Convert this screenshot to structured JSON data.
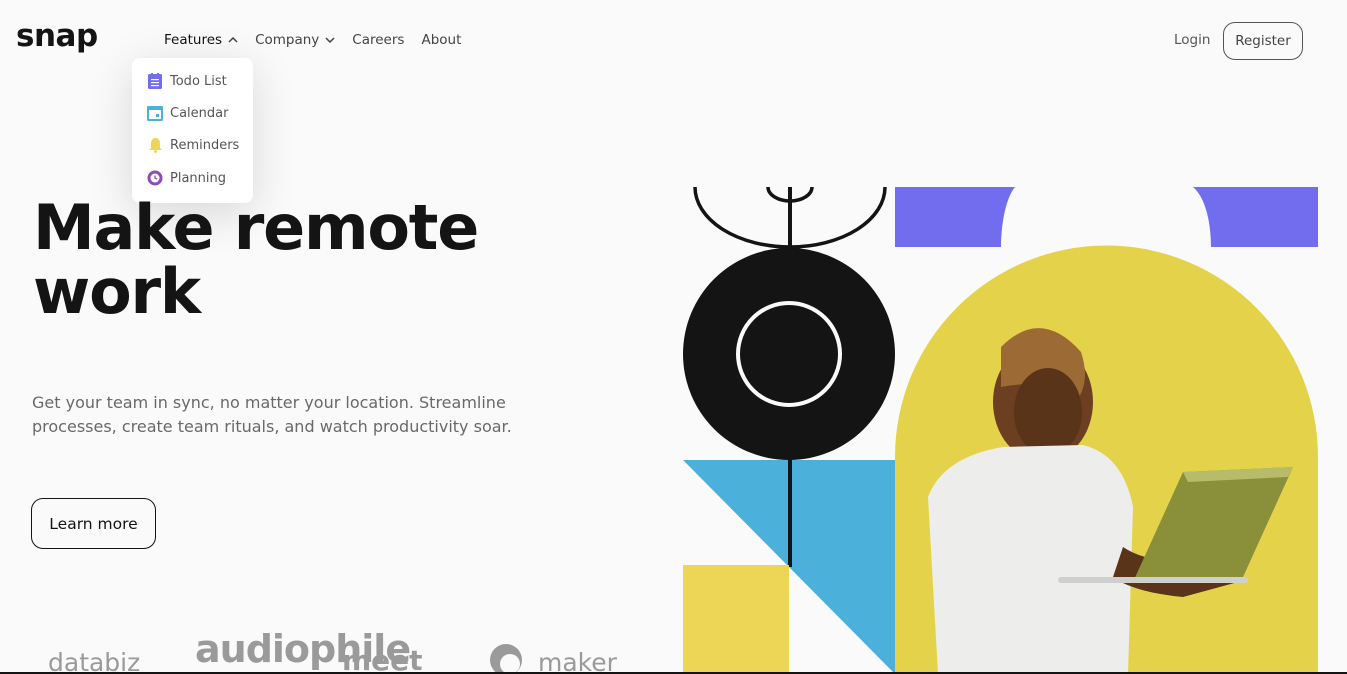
{
  "logo": "snap",
  "nav": {
    "features": "Features",
    "company": "Company",
    "careers": "Careers",
    "about": "About"
  },
  "features_menu": {
    "items": [
      {
        "label": "Todo List",
        "icon": "todo-list-icon",
        "color": "#726CEE"
      },
      {
        "label": "Calendar",
        "icon": "calendar-icon",
        "color": "#4BB1DA"
      },
      {
        "label": "Reminders",
        "icon": "bell-icon",
        "color": "#EDD556"
      },
      {
        "label": "Planning",
        "icon": "clock-icon",
        "color": "#8E4CB6"
      }
    ]
  },
  "auth": {
    "login": "Login",
    "register": "Register"
  },
  "hero": {
    "title_line1": "Make remote",
    "title_line2": "work",
    "subtitle": "Get your team in sync, no matter your location. Streamline processes, create team rituals, and watch productivity soar.",
    "cta": "Learn more"
  },
  "clients": [
    "databiz",
    "audiophile",
    "meet",
    "maker"
  ],
  "colors": {
    "almost_black": "#141414",
    "medium_gray": "#696969",
    "purple": "#726CEE",
    "blue": "#4BB1DA",
    "yellow": "#EDD556",
    "background": "#FAFAFA"
  }
}
